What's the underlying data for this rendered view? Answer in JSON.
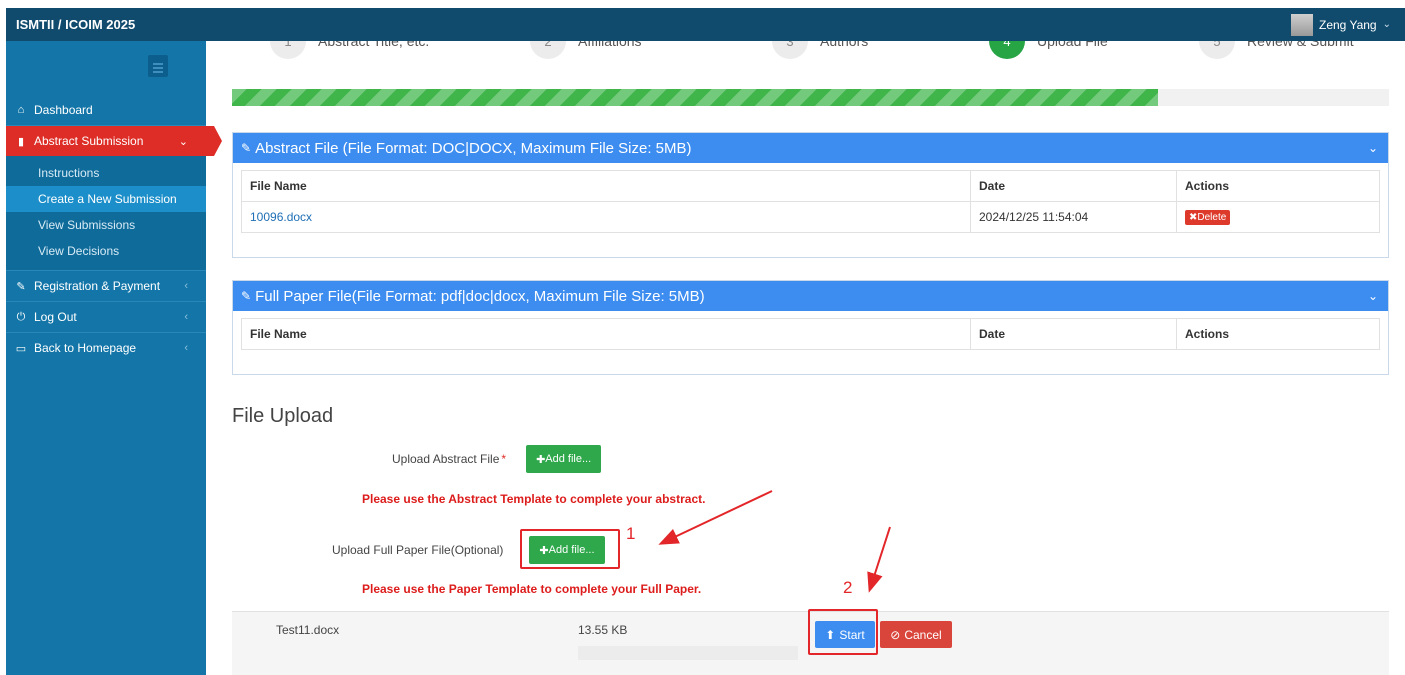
{
  "app": {
    "title": "ISMTII / ICOIM 2025",
    "user_name": "Zeng Yang"
  },
  "sidebar": {
    "items": [
      {
        "label": "Dashboard",
        "icon": "home-icon"
      },
      {
        "label": "Abstract Submission",
        "icon": "document-icon",
        "active": true
      },
      {
        "label": "Registration & Payment",
        "icon": "edit-icon"
      },
      {
        "label": "Log Out",
        "icon": "power-icon"
      },
      {
        "label": "Back to Homepage",
        "icon": "monitor-icon"
      }
    ],
    "submenu": [
      "Instructions",
      "Create a New Submission",
      "View Submissions",
      "View Decisions"
    ],
    "selected_submenu": "Create a New Submission"
  },
  "steps": [
    {
      "num": "1",
      "label": "Abstract Title, etc."
    },
    {
      "num": "2",
      "label": "Affiliations"
    },
    {
      "num": "3",
      "label": "Authors"
    },
    {
      "num": "4",
      "label": "Upload File",
      "current": true
    },
    {
      "num": "5",
      "label": "Review & Submit"
    }
  ],
  "progress_fraction": 0.8,
  "abstract_panel": {
    "title": "Abstract File (File Format: DOC|DOCX, Maximum File Size: 5MB)",
    "columns": [
      "File Name",
      "Date",
      "Actions"
    ],
    "rows": [
      {
        "file": "10096.docx",
        "date": "2024/12/25 11:54:04",
        "action": "Delete"
      }
    ]
  },
  "fullpaper_panel": {
    "title": "Full Paper File(File Format: pdf|doc|docx, Maximum File Size: 5MB)",
    "columns": [
      "File Name",
      "Date",
      "Actions"
    ]
  },
  "upload": {
    "title": "File Upload",
    "abstract_label": "Upload Abstract File",
    "required_mark": "*",
    "add_label": "Add file...",
    "abstract_warning": "Please use the Abstract Template to complete your abstract.",
    "paper_label": "Upload Full Paper File(Optional)",
    "paper_warning": "Please use the Paper Template to complete your Full Paper."
  },
  "queued_file": {
    "name": "Test11.docx",
    "size": "13.55 KB",
    "start_label": "Start",
    "cancel_label": "Cancel"
  },
  "annotations": {
    "one": "1",
    "two": "2"
  },
  "colors": {
    "topbar": "#104b6e",
    "sidebar": "#1476a8",
    "active_red": "#dd2d26",
    "panel_blue": "#3d8df0",
    "green": "#2ea84a",
    "annotation_red": "#e3262a"
  }
}
